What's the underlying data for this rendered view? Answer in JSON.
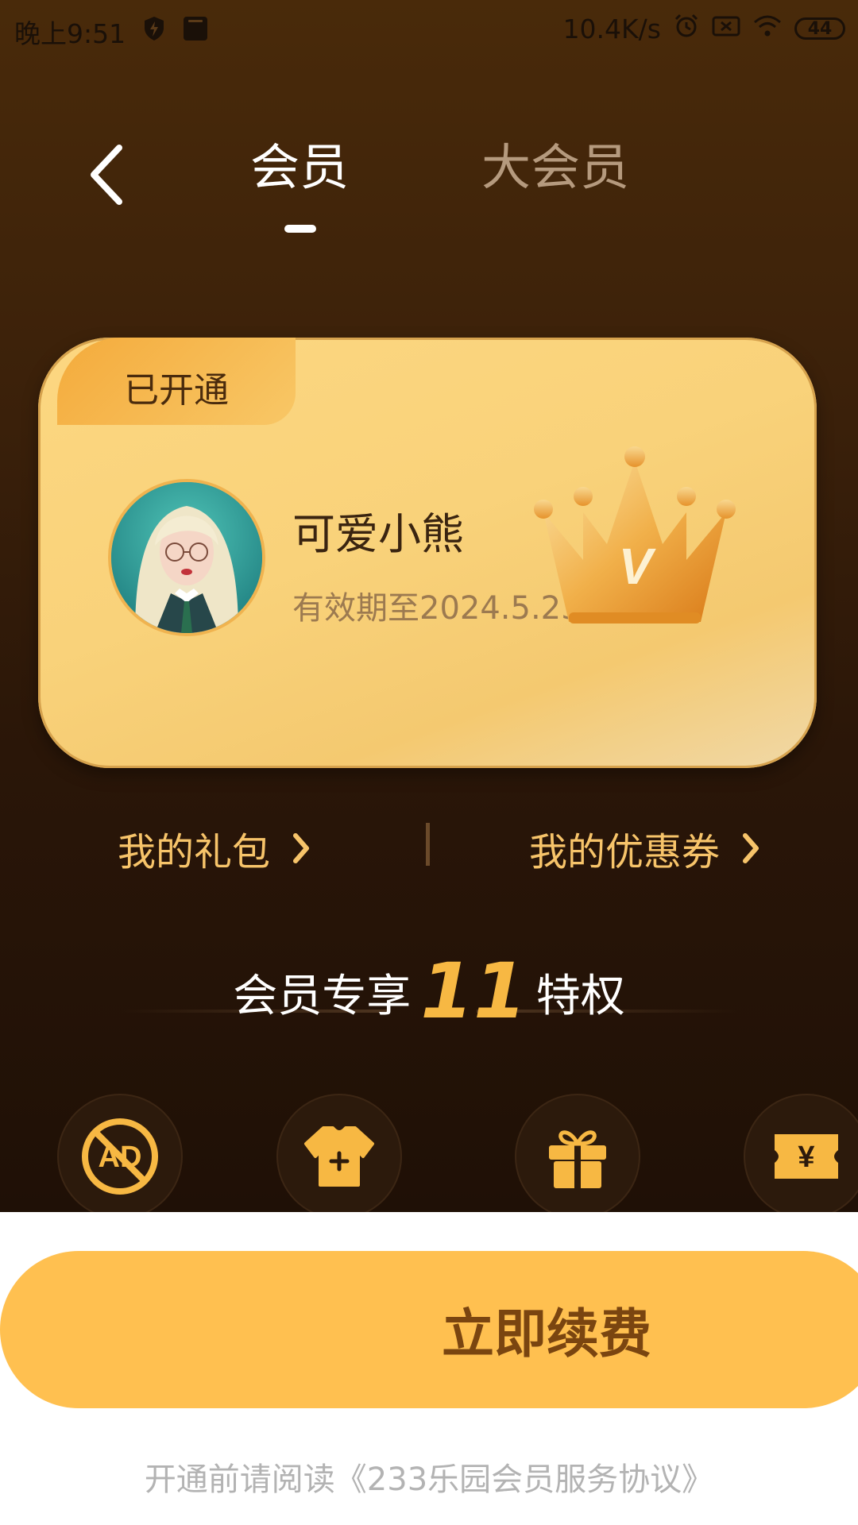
{
  "status_bar": {
    "time": "晚上9:51",
    "network_speed": "10.4K/s",
    "battery": "44",
    "icons": [
      "shield-bolt-icon",
      "mi-icon",
      "alarm-icon",
      "sim-x-icon",
      "wifi-icon",
      "battery-icon"
    ]
  },
  "header": {
    "tabs": [
      {
        "label": "会员",
        "active": true
      },
      {
        "label": "大会员",
        "active": false
      }
    ]
  },
  "card": {
    "tag": "已开通",
    "username": "可爱小熊",
    "expiry": "有效期至2024.5.23",
    "crown_letter": "V"
  },
  "links": {
    "gift": "我的礼包",
    "coupon": "我的优惠券"
  },
  "privileges": {
    "prefix": "会员专享",
    "count": "11",
    "suffix": "特权",
    "icons": [
      "no-ads-icon",
      "shirt-icon",
      "gift-icon",
      "coupon-icon"
    ],
    "icon_text": {
      "ad": "AD",
      "yen": "¥"
    }
  },
  "renew_button": "立即续费",
  "agreement": "开通前请阅读《233乐园会员服务协议》",
  "colors": {
    "accent": "#ffc050",
    "gold_text": "#f7c46a",
    "card": "#f9d27a",
    "background_dark": "#3a200a"
  }
}
